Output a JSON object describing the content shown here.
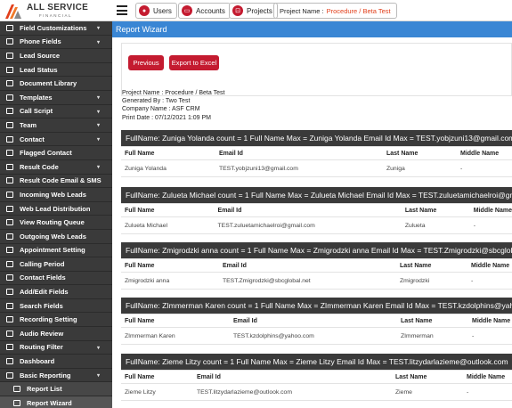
{
  "header": {
    "logo_title": "ALL SERVICE",
    "logo_sub": "FINANCIAL",
    "nav": [
      {
        "label": "Users",
        "icon": "person-icon"
      },
      {
        "label": "Accounts",
        "icon": "card-icon"
      },
      {
        "label": "Projects",
        "icon": "bookmark-icon"
      }
    ],
    "project_label": "Project Name :",
    "project_value": "Procedure / Beta Test"
  },
  "sidebar": {
    "items": [
      {
        "label": "Field Customizations",
        "arrow": true
      },
      {
        "label": "Phone Fields",
        "arrow": true
      },
      {
        "label": "Lead Source",
        "arrow": false
      },
      {
        "label": "Lead Status",
        "arrow": false
      },
      {
        "label": "Document Library",
        "arrow": false
      },
      {
        "label": "Templates",
        "arrow": true
      },
      {
        "label": "Call Script",
        "arrow": true
      },
      {
        "label": "Team",
        "arrow": true
      },
      {
        "label": "Contact",
        "arrow": true
      },
      {
        "label": "Flagged Contact",
        "arrow": false
      },
      {
        "label": "Result Code",
        "arrow": true
      },
      {
        "label": "Result Code Email & SMS",
        "arrow": false
      },
      {
        "label": "Incoming Web Leads",
        "arrow": false
      },
      {
        "label": "Web Lead Distribution",
        "arrow": false
      },
      {
        "label": "View Routing Queue",
        "arrow": false
      },
      {
        "label": "Outgoing Web Leads",
        "arrow": false
      },
      {
        "label": "Appointment Setting",
        "arrow": false
      },
      {
        "label": "Calling Period",
        "arrow": false
      },
      {
        "label": "Contact Fields",
        "arrow": false
      },
      {
        "label": "Add/Edit Fields",
        "arrow": false
      },
      {
        "label": "Search Fields",
        "arrow": false
      },
      {
        "label": "Recording Setting",
        "arrow": false
      },
      {
        "label": "Audio Review",
        "arrow": false
      },
      {
        "label": "Routing Filter",
        "arrow": true
      },
      {
        "label": "Dashboard",
        "arrow": false
      },
      {
        "label": "Basic Reporting",
        "arrow": true
      },
      {
        "label": "Report List",
        "arrow": false,
        "sub": true
      },
      {
        "label": "Report Wizard",
        "arrow": false,
        "sub": true,
        "active": true
      }
    ]
  },
  "main": {
    "title": "Report Wizard",
    "previous_label": "Previous",
    "export_label": "Export to Excel",
    "meta": [
      "Project Name : Procedure / Beta Test",
      "Generated By : Two Test",
      "Company Name : ASF CRM",
      "Print Date : 07/12/2021 1:09 PM"
    ],
    "columns": [
      "Full Name",
      "Email Id",
      "Last Name",
      "Middle Name"
    ],
    "groups": [
      {
        "heading": "FullName: Zuniga Yolanda count = 1 Full Name Max = Zuniga Yolanda  Email Id Max = TEST.yobjzuni13@gmail.com",
        "row": [
          "Zuniga Yolanda",
          "TEST.yobjzuni13@gmail.com",
          "Zuniga",
          "-"
        ]
      },
      {
        "heading": "FullName: Zulueta Michael count = 1 Full Name Max = Zulueta Michael  Email Id Max = TEST.zuluetamichaelroi@gmail.com",
        "row": [
          "Zulueta Michael",
          "TEST.zuluetamichaelroi@gmail.com",
          "Zulueta",
          "-"
        ]
      },
      {
        "heading": "FullName: Zmigrodzki anna count = 1 Full Name Max = Zmigrodzki anna  Email Id Max = TEST.Zmigrodzki@sbcglobal.net",
        "row": [
          "Zmigrodzki anna",
          "TEST.Zmigrodzki@sbcglobal.net",
          "Zmigrodzki",
          "-"
        ]
      },
      {
        "heading": "FullName: ZImmerman Karen count = 1 Full Name Max = ZImmerman Karen  Email Id Max = TEST.kzdolphins@yahoo.com",
        "row": [
          "ZImmerman Karen",
          "TEST.kzdolphins@yahoo.com",
          "ZImmerman",
          "-"
        ]
      },
      {
        "heading": "FullName: Zieme Litzy count = 1 Full Name Max = Zieme Litzy  Email Id Max = TEST.litzydarlazieme@outlook.com",
        "row": [
          "Zieme Litzy",
          "TEST.litzydarlazieme@outlook.com",
          "Zieme",
          "-"
        ]
      }
    ]
  }
}
